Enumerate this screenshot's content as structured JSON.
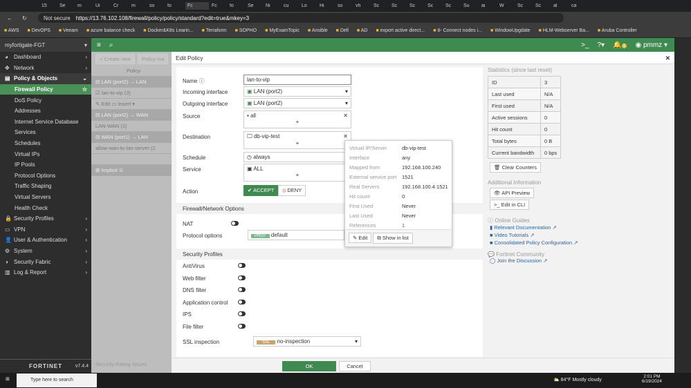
{
  "browser": {
    "tabs": [
      "15",
      "Se",
      "m",
      "Ui",
      "Cr",
      "m",
      "so",
      "fo",
      "Fc",
      "Fc",
      "fo",
      "Se",
      "Ni",
      "cu",
      "Lo",
      "Hi",
      "so",
      "vh",
      "Sc",
      "Sc",
      "Sc",
      "Sc",
      "Sc",
      "Su",
      "ai",
      "W",
      "Sc",
      "Sc",
      "al",
      "ca"
    ],
    "security": "Not secure",
    "url": "https://13.76.102.108/firewall/policy/policy/standard?edit=true&mkey=3",
    "bookmarks": [
      "AWS",
      "DevOPS",
      "Veeam",
      "azure balance check",
      "Docker&K8s Learin...",
      "Terraform",
      "SOPHO",
      "MyExamTopic",
      "Ansible",
      "Dell",
      "AD",
      "export active direct...",
      "8- Connect nodes i...",
      "WindowUpgdate",
      "HLM-Webserver Ba...",
      "Aruba Controller"
    ]
  },
  "sidebar": {
    "device": "myfortigate-FGT",
    "items": [
      {
        "label": "Dashboard",
        "type": "top"
      },
      {
        "label": "Network",
        "type": "top"
      },
      {
        "label": "Policy & Objects",
        "type": "head"
      },
      {
        "label": "Firewall Policy",
        "type": "active"
      },
      {
        "label": "DoS Policy",
        "type": "sub"
      },
      {
        "label": "Addresses",
        "type": "sub"
      },
      {
        "label": "Internet Service Database",
        "type": "sub"
      },
      {
        "label": "Services",
        "type": "sub"
      },
      {
        "label": "Schedules",
        "type": "sub"
      },
      {
        "label": "Virtual IPs",
        "type": "sub"
      },
      {
        "label": "IP Pools",
        "type": "sub"
      },
      {
        "label": "Protocol Options",
        "type": "sub"
      },
      {
        "label": "Traffic Shaping",
        "type": "sub"
      },
      {
        "label": "Virtual Servers",
        "type": "sub"
      },
      {
        "label": "Health Check",
        "type": "sub"
      },
      {
        "label": "Security Profiles",
        "type": "top"
      },
      {
        "label": "VPN",
        "type": "top"
      },
      {
        "label": "User & Authentication",
        "type": "top"
      },
      {
        "label": "System",
        "type": "top"
      },
      {
        "label": "Security Fabric",
        "type": "top"
      },
      {
        "label": "Log & Report",
        "type": "top"
      }
    ],
    "brand": "FORTINET",
    "version": "v7.4.4"
  },
  "header": {
    "notifications": "1",
    "user": "pmmz"
  },
  "list": {
    "create": "+ Create new",
    "search": "Policy ma",
    "col": "Policy",
    "rows": [
      {
        "t": "⊟ LAN (port2) → LAN",
        "g": true
      },
      {
        "t": "☑ lan-to-vip (3)",
        "g": false
      },
      {
        "t": "✎ Edit  ▭ Insert ▾",
        "g": false
      },
      {
        "t": "⊟ LAN (port2) → WAN",
        "g": true
      },
      {
        "t": "LAN-WAN (1)",
        "g": false
      },
      {
        "t": "⊟ WAN (port1) → LAN",
        "g": true
      },
      {
        "t": "allow-wan-to-lan-server (2",
        "g": false
      },
      {
        "t": "",
        "g": false
      },
      {
        "t": "⊞ Implicit ①",
        "g": true
      }
    ],
    "rating": "Security Rating Issues"
  },
  "edit": {
    "title": "Edit Policy",
    "name_label": "Name",
    "name": "lan-to-vip",
    "incoming_label": "Incoming interface",
    "incoming": "LAN (port2)",
    "outgoing_label": "Outgoing interface",
    "outgoing": "LAN (port2)",
    "source_label": "Source",
    "source": "all",
    "dest_label": "Destination",
    "dest": "db-vip-test",
    "schedule_label": "Schedule",
    "schedule": "always",
    "service_label": "Service",
    "service": "ALL",
    "action_label": "Action",
    "accept": "ACCEPT",
    "deny": "DENY",
    "fw_section": "Firewall/Network Options",
    "nat_label": "NAT",
    "proto_label": "Protocol options",
    "proto_badge": "PROT",
    "proto": "default",
    "sec_section": "Security Profiles",
    "profiles": [
      "AntiVirus",
      "Web filter",
      "DNS filter",
      "Application control",
      "IPS",
      "File filter"
    ],
    "ssl_label": "SSL inspection",
    "ssl_badge": "SSL",
    "ssl": "no-inspection",
    "ok": "OK",
    "cancel": "Cancel"
  },
  "popup": {
    "rows": [
      [
        "Virtual IP/Server",
        "db-vip-test"
      ],
      [
        "Interface",
        "any"
      ],
      [
        "Mapped from",
        "192.168.100.240"
      ],
      [
        "External service port",
        "1521"
      ],
      [
        "Real Servers",
        "192.168.100.4:1521"
      ],
      [
        "Hit count",
        "0"
      ],
      [
        "First Used",
        "Never"
      ],
      [
        "Last Used",
        "Never"
      ],
      [
        "References",
        "1"
      ]
    ],
    "edit": "Edit",
    "show": "Show in list"
  },
  "stats": {
    "title": "Statistics (since last reset)",
    "rows": [
      [
        "ID",
        "3"
      ],
      [
        "Last used",
        "N/A"
      ],
      [
        "First used",
        "N/A"
      ],
      [
        "Active sessions",
        "0"
      ],
      [
        "Hit count",
        "0"
      ],
      [
        "Total bytes",
        "0 B"
      ],
      [
        "Current bandwidth",
        "0 bps"
      ]
    ],
    "clear": "Clear Counters",
    "addl": "Additional Information",
    "api": "API Preview",
    "cli": "Edit in CLI",
    "guides": "Online Guides",
    "links": [
      "Relevant Documentation",
      "Video Tutorials",
      "Consolidated Policy Configuration"
    ],
    "community": "Fortinet Community",
    "discuss": "Join the Discussion"
  },
  "taskbar": {
    "search": "Type here to search",
    "weather": "84°F  Mostly cloudy",
    "time": "2:01 PM",
    "date": "6/19/2024"
  }
}
